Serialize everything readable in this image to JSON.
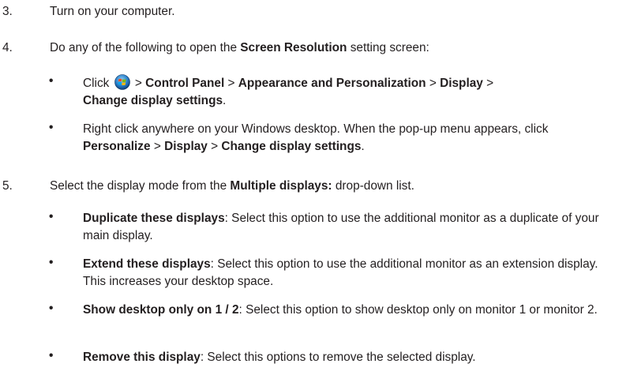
{
  "steps": [
    {
      "num": "3.",
      "text": "Turn on your computer."
    },
    {
      "num": "4.",
      "text_a": "Do any of the following to open the ",
      "text_b": "Screen Resolution",
      "text_c": " setting screen:"
    },
    {
      "num": "5.",
      "text_a": "Select the display mode from the ",
      "text_b": "Multiple displays:",
      "text_c": " drop-down list."
    }
  ],
  "step4_bullets": {
    "b1": {
      "click": "Click ",
      "sep1": " > ",
      "cp": "Control Panel",
      "sep2": " > ",
      "ap": "Appearance and Personalization",
      "sep3": " > ",
      "display": "Display",
      "sep4": " >",
      "cds": "Change display settings",
      "end": "."
    },
    "b2": {
      "line": "Right click anywhere on your Windows desktop. When the pop-up menu appears, click ",
      "personalize": "Personalize",
      "sep1": " > ",
      "display": "Display",
      "sep2": " > ",
      "cds": "Change display settings",
      "end": "."
    }
  },
  "step5_bullets": [
    {
      "term": "Duplicate these displays",
      "desc": ": Select this option to use the additional monitor as a duplicate of your main display."
    },
    {
      "term": "Extend these displays",
      "desc": ": Select this option to use the additional monitor as an extension display. This increases your desktop space."
    },
    {
      "term": "Show desktop only on 1 / 2",
      "desc": ": Select this option to show desktop only on monitor 1 or monitor 2."
    },
    {
      "term": "Remove this display",
      "desc": ": Select this options to remove the selected display."
    }
  ],
  "bullet_char": "•",
  "icons": {
    "start": "windows-start-orb-icon"
  }
}
